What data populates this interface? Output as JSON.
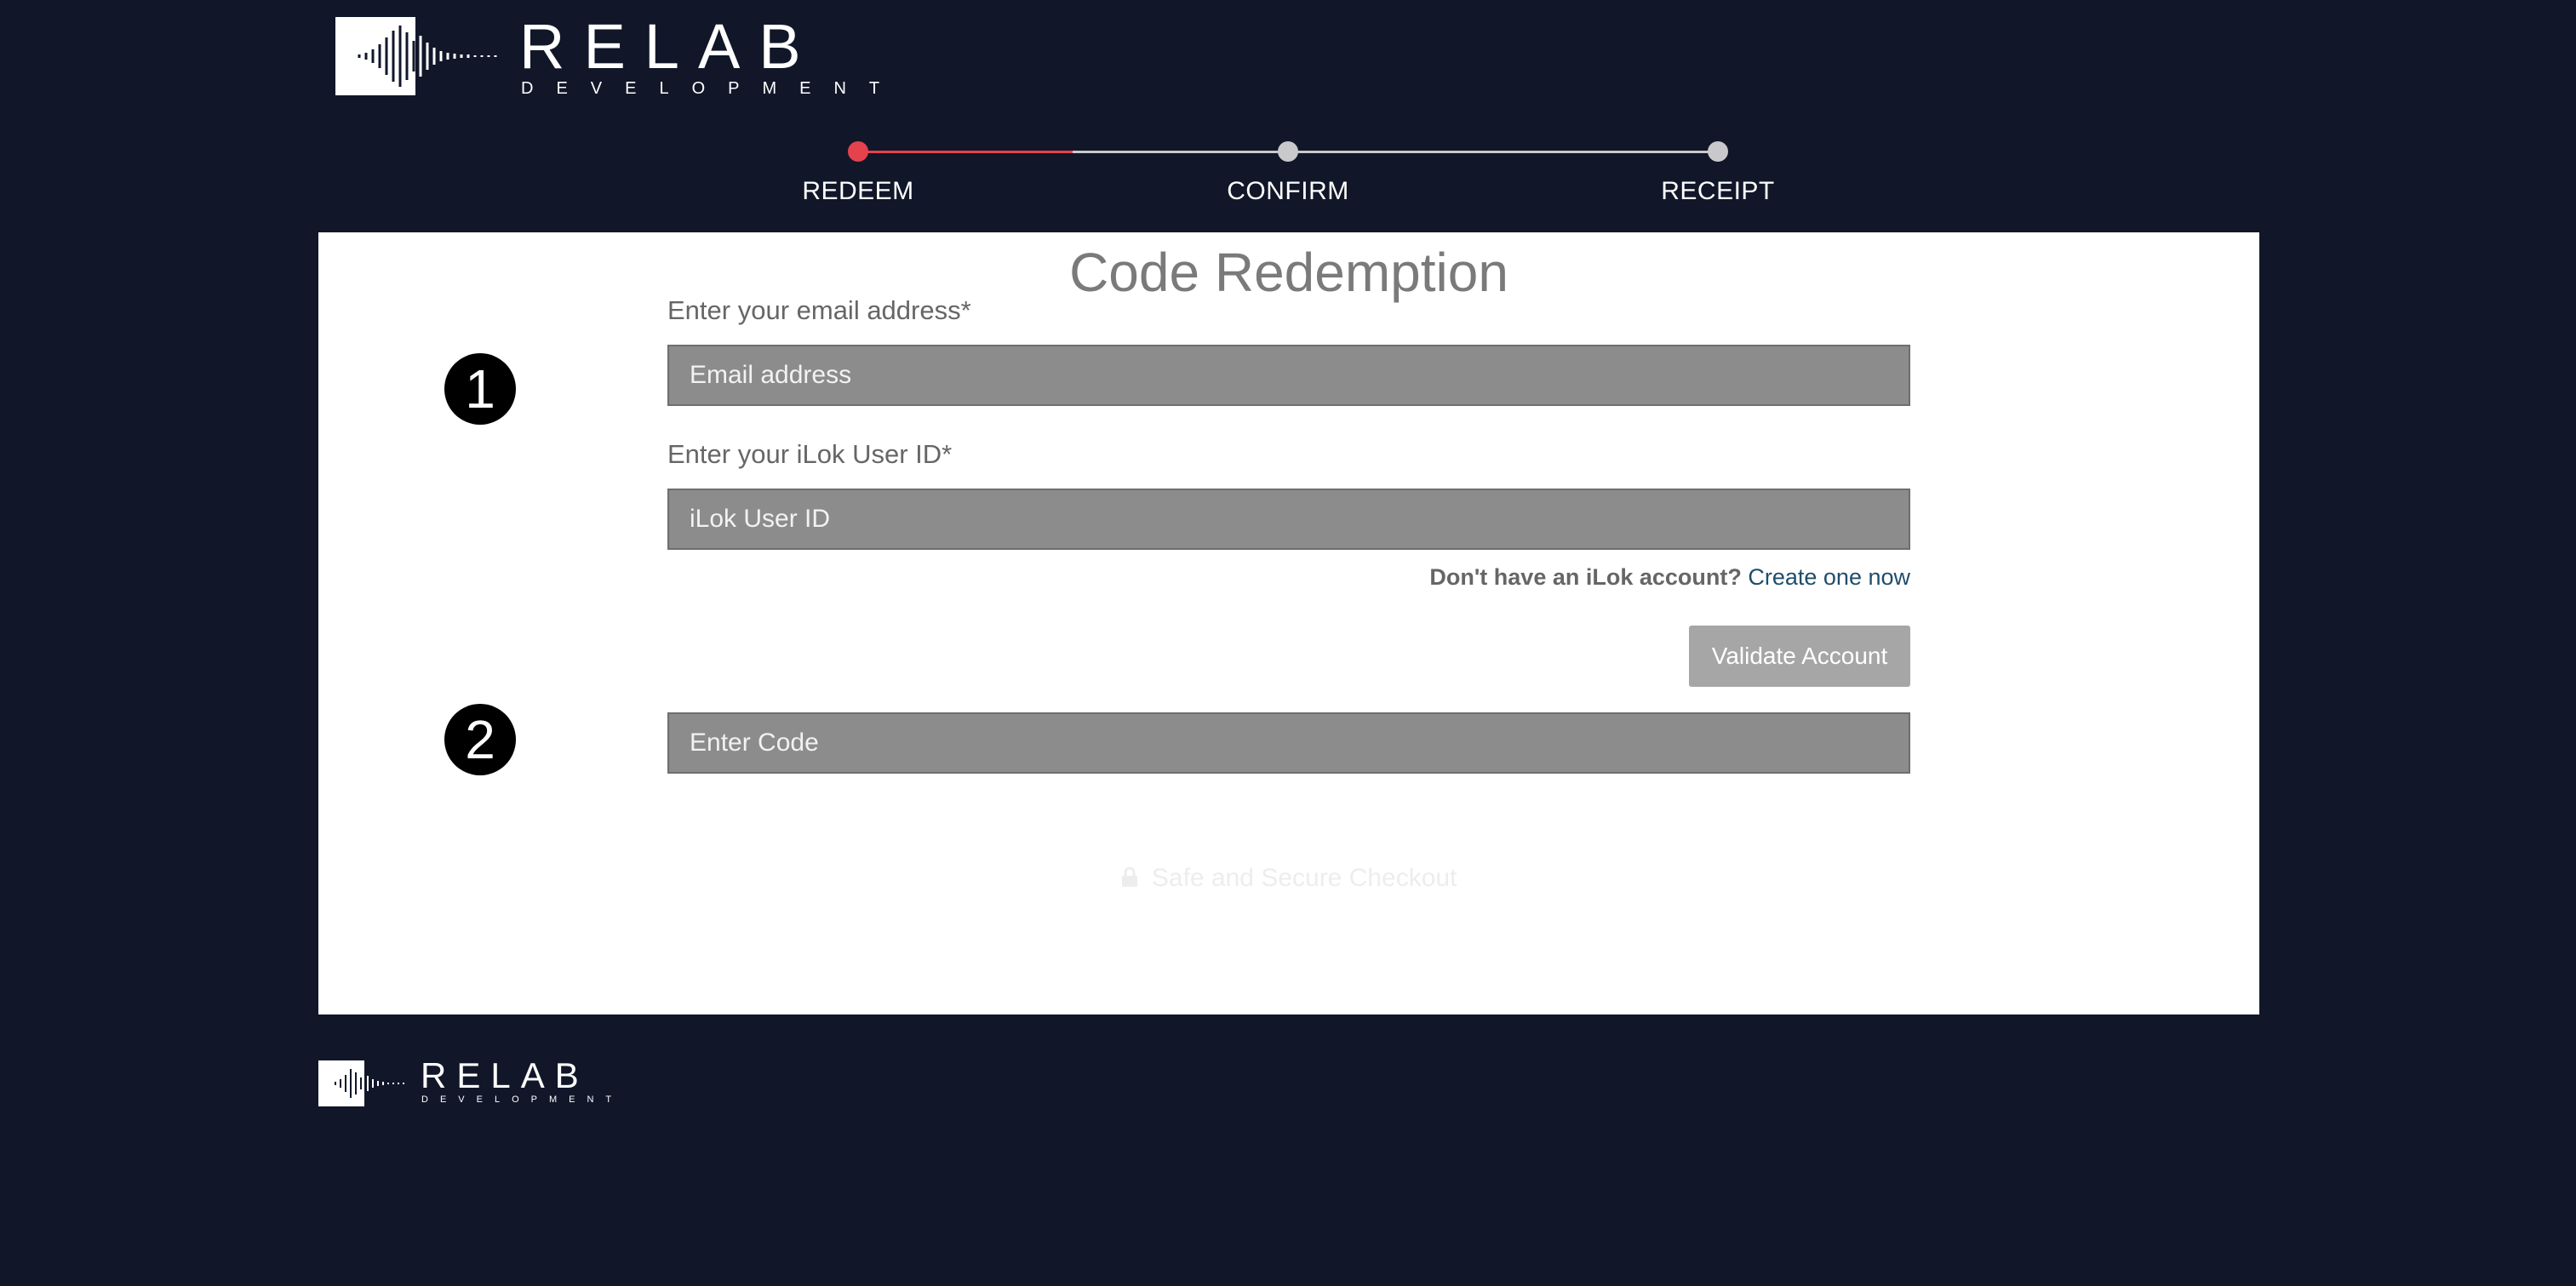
{
  "brand": {
    "name": "RELAB",
    "tagline": "DEVELOPMENT"
  },
  "steps": [
    {
      "label": "REDEEM",
      "active": true
    },
    {
      "label": "CONFIRM",
      "active": false
    },
    {
      "label": "RECEIPT",
      "active": false
    }
  ],
  "form": {
    "title": "Code Redemption",
    "step1_number": "1",
    "step2_number": "2",
    "email_label": "Enter your email address*",
    "email_placeholder": "Email address",
    "ilok_label": "Enter your iLok User ID*",
    "ilok_placeholder": "iLok User ID",
    "account_question": "Don't have an iLok account?",
    "account_link": "Create one now",
    "validate_label": "Validate Account",
    "code_placeholder": "Enter Code",
    "secure_text": "Safe and Secure Checkout"
  },
  "colors": {
    "background": "#111729",
    "accent": "#e5424d",
    "inactive_step": "#c9c9cc",
    "field_bg": "#8c8c8c",
    "link": "#1f4d6b"
  }
}
